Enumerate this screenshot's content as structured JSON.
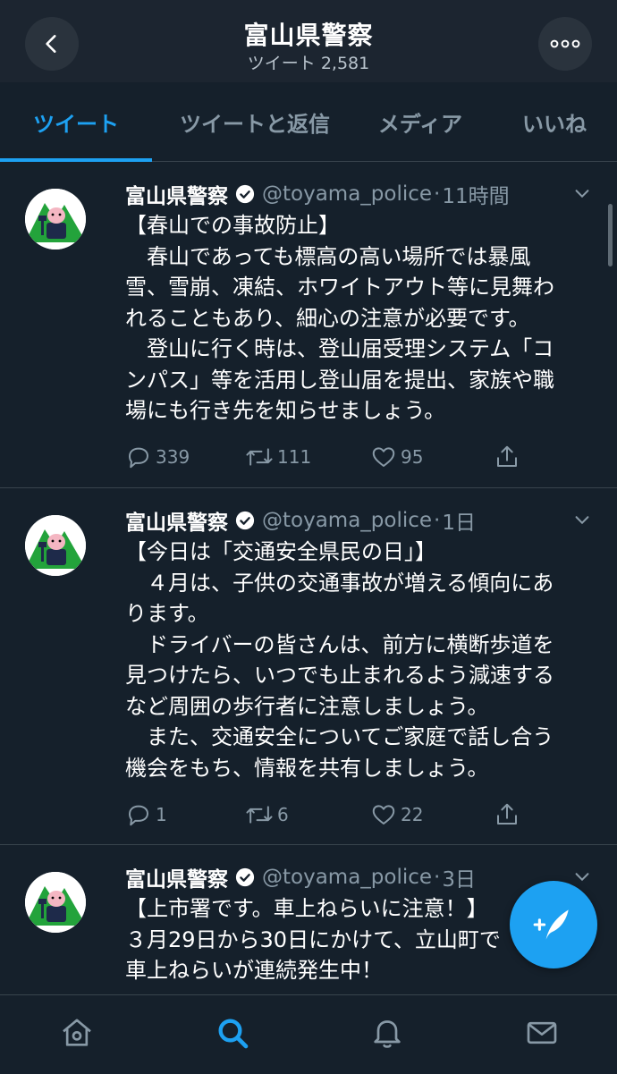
{
  "header": {
    "title": "富山県警察",
    "subtitle": "ツイート 2,581",
    "back_icon": "chevron-left-icon",
    "more_icon": "more-horizontal-icon"
  },
  "tabs": [
    {
      "label": "ツイート",
      "active": true
    },
    {
      "label": "ツイートと返信",
      "active": false
    },
    {
      "label": "メディア",
      "active": false
    },
    {
      "label": "いいね",
      "active": false
    }
  ],
  "tweets": [
    {
      "name": "富山県警察",
      "handle": "@toyama_police",
      "dot": "·",
      "time": "11時間",
      "lines": [
        "【春山での事故防止】",
        "　春山であっても標高の高い場所では暴風",
        "雪、雪崩、凍結、ホワイトアウト等に見舞わ",
        "れることもあり、細心の注意が必要です。",
        "　登山に行く時は、登山届受理システム「コ",
        "ンパス」等を活用し登山届を提出、家族や職",
        "場にも行き先を知らせましょう。"
      ],
      "replies": "339",
      "retweets": "111",
      "likes": "95"
    },
    {
      "name": "富山県警察",
      "handle": "@toyama_police",
      "dot": "·",
      "time": "1日",
      "lines": [
        "【今日は「交通安全県民の日」】",
        "　４月は、子供の交通事故が増える傾向にあ",
        "ります。",
        "　ドライバーの皆さんは、前方に横断歩道を",
        "見つけたら、いつでも止まれるよう減速する",
        "など周囲の歩行者に注意しましょう。",
        "　また、交通安全についてご家庭で話し合う",
        "機会をもち、情報を共有しましょう。"
      ],
      "replies": "1",
      "retweets": "6",
      "likes": "22"
    },
    {
      "name": "富山県警察",
      "handle": "@toyama_police",
      "dot": "·",
      "time": "3日",
      "lines": [
        "【上市署です。車上ねらいに注意！】",
        "３月29日から30日にかけて、立山町で",
        "車上ねらいが連続発生中！"
      ]
    }
  ],
  "fab": {
    "icon": "compose-tweet-icon"
  },
  "bottom_nav": [
    {
      "icon": "home-icon"
    },
    {
      "icon": "search-icon",
      "active": true
    },
    {
      "icon": "notifications-bell-icon"
    },
    {
      "icon": "messages-envelope-icon"
    }
  ],
  "colors": {
    "background": "#15202b",
    "accent": "#1da1f2",
    "muted": "#8899a6",
    "divider": "#38444d"
  }
}
